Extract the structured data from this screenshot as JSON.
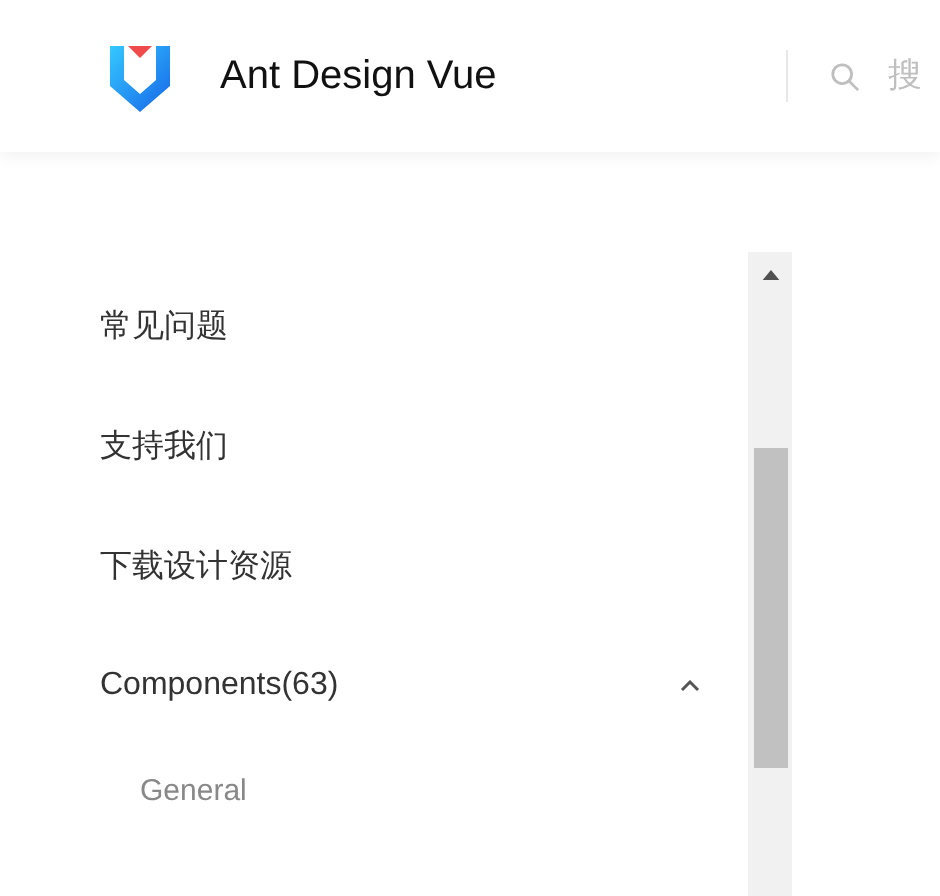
{
  "header": {
    "title": "Ant Design Vue",
    "search": {
      "placeholder": "搜"
    }
  },
  "menu": {
    "items": [
      {
        "label": "常见问题"
      },
      {
        "label": "支持我们"
      },
      {
        "label": "下载设计资源"
      },
      {
        "label": "Components(63)",
        "expanded": true,
        "children": [
          {
            "label": "General"
          }
        ]
      }
    ]
  }
}
